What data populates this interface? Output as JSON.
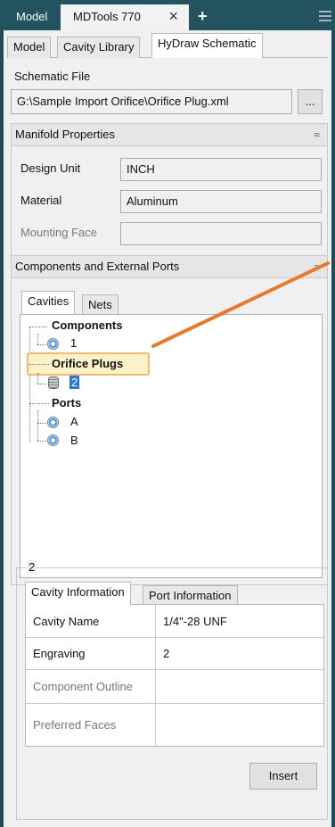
{
  "top_tabs": {
    "model": "Model",
    "mdtools": "MDTools 770",
    "close": "×",
    "plus": "+"
  },
  "sub_tabs": [
    "Model",
    "Cavity Library",
    "HyDraw Schematic"
  ],
  "schematic_file": {
    "label": "Schematic File",
    "path": "G:\\Sample Import Orifice\\Orifice Plug.xml",
    "browse": "..."
  },
  "manifold": {
    "title": "Manifold Properties",
    "collapse": "≈",
    "rows": [
      {
        "label": "Design Unit",
        "value": "INCH"
      },
      {
        "label": "Material",
        "value": "Aluminum"
      },
      {
        "label": "Mounting Face",
        "value": ""
      }
    ]
  },
  "components": {
    "title": "Components and External Ports",
    "collapse": "≈",
    "tabs": [
      "Cavities",
      "Nets"
    ],
    "tree": {
      "components_label": "Components",
      "component_items": [
        "1"
      ],
      "orifice_label": "Orifice Plugs",
      "orifice_items": [
        "2"
      ],
      "ports_label": "Ports",
      "port_items": [
        "A",
        "B"
      ]
    }
  },
  "details": {
    "group_label": "2",
    "tabs": [
      "Cavity Information",
      "Port Information"
    ],
    "rows": [
      {
        "name": "Cavity Name",
        "value": "1/4\"-28 UNF"
      },
      {
        "name": "Engraving",
        "value": "2"
      },
      {
        "name": "Component Outline",
        "value": ""
      },
      {
        "name": "Preferred Faces",
        "value": ""
      }
    ],
    "insert_button": "Insert"
  },
  "colors": {
    "accent_arrow": "#e8782a",
    "highlight_fill": "#fdf1c8",
    "selection": "#2f76c9"
  }
}
